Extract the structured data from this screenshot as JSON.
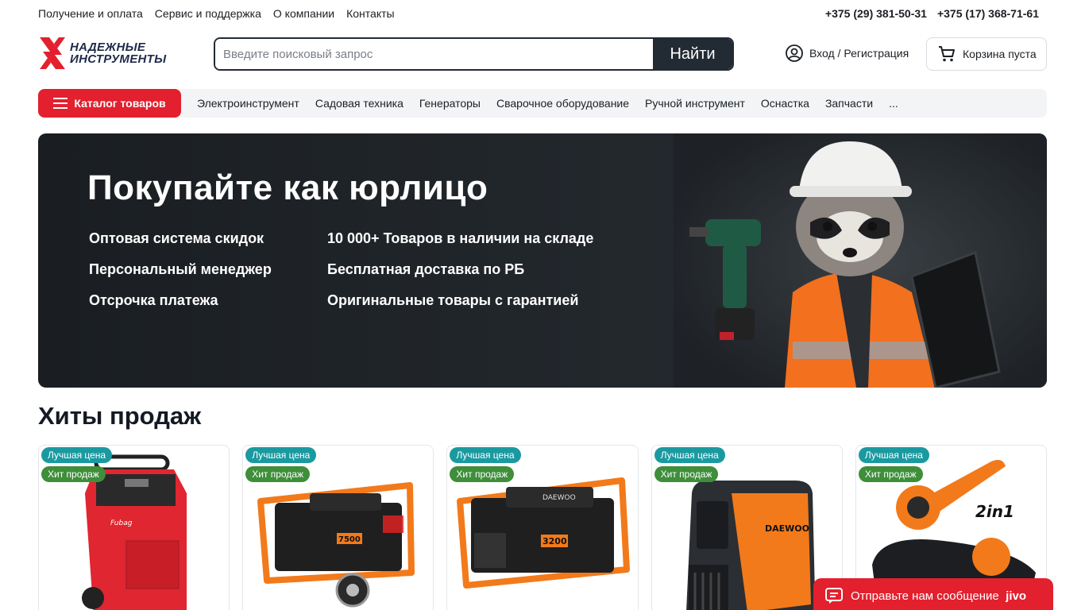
{
  "topbar": {
    "links": [
      "Получение и оплата",
      "Сервис и поддержка",
      "О компании",
      "Контакты"
    ],
    "phones": [
      "+375 (29) 381-50-31",
      "+375 (17) 368-71-61"
    ]
  },
  "header": {
    "logo_line1": "НАДЕЖНЫЕ",
    "logo_line2": "ИНСТРУМЕНТЫ",
    "search_placeholder": "Введите поисковый запрос",
    "search_button": "Найти",
    "login_label": "Вход / Регистрация",
    "cart_label": "Корзина пуста"
  },
  "nav": {
    "catalog_label": "Каталог товаров",
    "items": [
      "Электроинструмент",
      "Садовая техника",
      "Генераторы",
      "Сварочное оборудование",
      "Ручной инструмент",
      "Оснастка",
      "Запчасти",
      "..."
    ]
  },
  "banner": {
    "title": "Покупайте как юрлицо",
    "benefits": [
      "Оптовая система скидок",
      "10 000+ Товаров в наличии на складе",
      "Персональный менеджер",
      "Бесплатная доставка по РБ",
      "Отсрочка платежа",
      "Оригинальные товары с гарантией"
    ]
  },
  "hits": {
    "title": "Хиты продаж",
    "badge_best": "Лучшая цена",
    "badge_hit": "Хит продаж",
    "products": [
      {
        "image": "battery-charger-image"
      },
      {
        "image": "generator-7500-image",
        "model": "7500"
      },
      {
        "image": "generator-3200-image",
        "model": "3200"
      },
      {
        "image": "inverter-generator-image"
      },
      {
        "image": "leaf-blower-image",
        "label": "2in1"
      }
    ]
  },
  "chat": {
    "label": "Отправьте нам сообщение",
    "brand": "jivo"
  },
  "colors": {
    "accent_red": "#e3202e",
    "dark": "#222a33",
    "badge_best": "#1a9aa0",
    "badge_hit": "#3e8e3a"
  }
}
